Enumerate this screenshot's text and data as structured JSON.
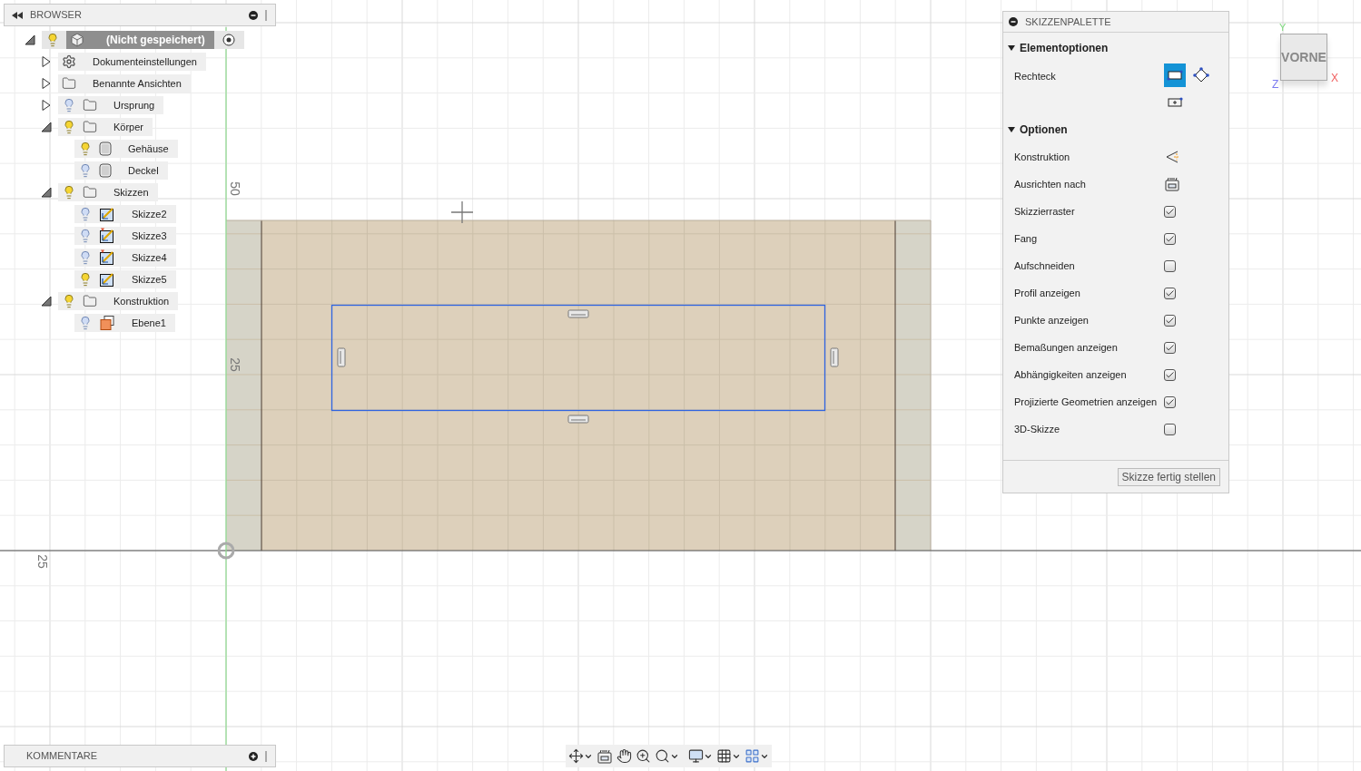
{
  "browser": {
    "title": "BROWSER",
    "tree": [
      {
        "kind": "document",
        "label": "(Nicht gespeichert)",
        "visible": true,
        "expanded": true,
        "selected": true,
        "children": [
          {
            "kind": "settings",
            "label": "Dokumenteinstellungen",
            "expanded": false,
            "selected": false
          },
          {
            "kind": "folder",
            "label": "Benannte Ansichten",
            "expanded": false,
            "selected": false
          },
          {
            "kind": "folder",
            "label": "Ursprung",
            "visible": false,
            "expanded": false,
            "selected": false
          },
          {
            "kind": "folder",
            "label": "Körper",
            "visible": true,
            "expanded": true,
            "selected": false,
            "children": [
              {
                "kind": "body",
                "label": "Gehäuse",
                "visible": true,
                "selected": false
              },
              {
                "kind": "body",
                "label": "Deckel",
                "visible": false,
                "selected": false
              }
            ]
          },
          {
            "kind": "folder",
            "label": "Skizzen",
            "visible": true,
            "expanded": true,
            "selected": false,
            "children": [
              {
                "kind": "sketch",
                "label": "Skizze2",
                "visible": false,
                "warning": false,
                "selected": false
              },
              {
                "kind": "sketch",
                "label": "Skizze3",
                "visible": false,
                "warning": true,
                "selected": false
              },
              {
                "kind": "sketch",
                "label": "Skizze4",
                "visible": false,
                "warning": true,
                "selected": false
              },
              {
                "kind": "sketch",
                "label": "Skizze5",
                "visible": true,
                "warning": false,
                "selected": false
              }
            ]
          },
          {
            "kind": "folder",
            "label": "Konstruktion",
            "visible": true,
            "expanded": true,
            "selected": false,
            "children": [
              {
                "kind": "plane",
                "label": "Ebene1",
                "visible": false,
                "selected": false
              }
            ]
          }
        ]
      }
    ]
  },
  "canvas": {
    "labels": [
      "50",
      "25",
      "25"
    ]
  },
  "palette": {
    "title": "SKIZZENPALETTE",
    "sections": [
      {
        "title": "Elementoptionen",
        "expanded": true,
        "rows": [
          {
            "kind": "tools",
            "label": "Rechteck",
            "tools": [
              {
                "kind": "corner",
                "selected": true
              },
              {
                "kind": "angled",
                "selected": false
              },
              {
                "kind": "center",
                "selected": false
              }
            ]
          }
        ]
      },
      {
        "title": "Optionen",
        "expanded": true,
        "rows": [
          {
            "kind": "construction",
            "label": "Konstruktion"
          },
          {
            "kind": "look-at",
            "label": "Ausrichten nach"
          },
          {
            "kind": "checkbox",
            "label": "Skizzierraster",
            "checked": true
          },
          {
            "kind": "checkbox",
            "label": "Fang",
            "checked": true
          },
          {
            "kind": "checkbox",
            "label": "Aufschneiden",
            "checked": false
          },
          {
            "kind": "checkbox",
            "label": "Profil anzeigen",
            "checked": true
          },
          {
            "kind": "checkbox",
            "label": "Punkte anzeigen",
            "checked": true
          },
          {
            "kind": "checkbox",
            "label": "Bemaßungen anzeigen",
            "checked": true
          },
          {
            "kind": "checkbox",
            "label": "Abhängigkeiten anzeigen",
            "checked": true
          },
          {
            "kind": "checkbox",
            "label": "Projizierte Geometrien anzeigen",
            "checked": true
          },
          {
            "kind": "checkbox",
            "label": "3D-Skizze",
            "checked": false
          }
        ]
      }
    ],
    "button": "Skizze fertig stellen"
  },
  "viewcube": {
    "face": "VORNE",
    "axes": [
      "Y",
      "X",
      "Z"
    ]
  },
  "comments": {
    "title": "KOMMENTARE"
  }
}
